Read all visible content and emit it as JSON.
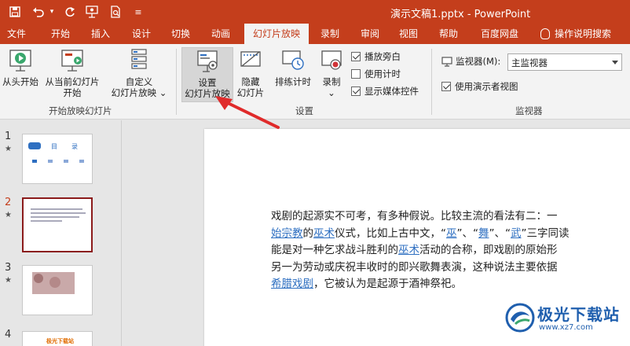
{
  "window": {
    "title": "演示文稿1.pptx  -  PowerPoint",
    "title_bar_color": "#c43e1c"
  },
  "quick_access": [
    "save-icon",
    "undo-icon",
    "redo-icon",
    "presenter-icon",
    "print-preview-icon",
    "customize-icon"
  ],
  "tabs": [
    {
      "label": "文件"
    },
    {
      "label": "开始"
    },
    {
      "label": "插入"
    },
    {
      "label": "设计"
    },
    {
      "label": "切换"
    },
    {
      "label": "动画"
    },
    {
      "label": "幻灯片放映",
      "active": true
    },
    {
      "label": "录制"
    },
    {
      "label": "审阅"
    },
    {
      "label": "视图"
    },
    {
      "label": "帮助"
    },
    {
      "label": "百度网盘"
    }
  ],
  "tell_me": "操作说明搜索",
  "ribbon": {
    "start": {
      "from_beginning": "从头开始",
      "from_current_1": "从当前幻灯片",
      "from_current_2": "开始",
      "custom_1": "自定义",
      "custom_2": "幻灯片放映",
      "custom_arrow": "⌄",
      "group_label": "开始放映幻灯片"
    },
    "setup": {
      "setup_show_1": "设置",
      "setup_show_2": "幻灯片放映",
      "hide_slide_1": "隐藏",
      "hide_slide_2": "幻灯片",
      "rehearse": "排练计时",
      "record": "录制",
      "record_arrow": "⌄",
      "play_narrations": "播放旁白",
      "use_timings": "使用计时",
      "show_media_controls": "显示媒体控件",
      "group_label": "设置"
    },
    "monitors": {
      "monitor_label": "监视器(M):",
      "monitor_value": "主监视器",
      "presenter_view": "使用演示者视图",
      "group_label": "监视器"
    }
  },
  "slides": [
    {
      "number": "1",
      "star": "★",
      "title_left": "目",
      "title_right": "录"
    },
    {
      "number": "2",
      "star": "★",
      "active": true
    },
    {
      "number": "3",
      "star": "★"
    },
    {
      "number": "4",
      "thumb_text": "极光下载站"
    }
  ],
  "slide_body": {
    "line1": "戏剧的起源实不可考，有多种假说。比较主流的看法有二：一",
    "line2_link1": "始宗教",
    "line2_t1": "的",
    "line2_link2": "巫术",
    "line2_t2": "仪式，比如上古中文，“",
    "line2_link3": "巫",
    "line2_t3": "”、“",
    "line2_link4": "舞",
    "line2_t4": "”、“",
    "line2_link5": "武",
    "line2_t5": "”三字同读",
    "line3_t1": "能是对一种乞求战斗胜利的",
    "line3_link": "巫术",
    "line3_t2": "活动的合称，即戏剧的原始形",
    "line4": "另一为劳动或庆祝丰收时的即兴歌舞表演，这种说法主要依据",
    "line5_link": "希腊戏剧",
    "line5_t": "，它被认为是起源于酒神祭祀。"
  },
  "watermark": {
    "name": "极光下载站",
    "url": "www.xz7.com"
  }
}
